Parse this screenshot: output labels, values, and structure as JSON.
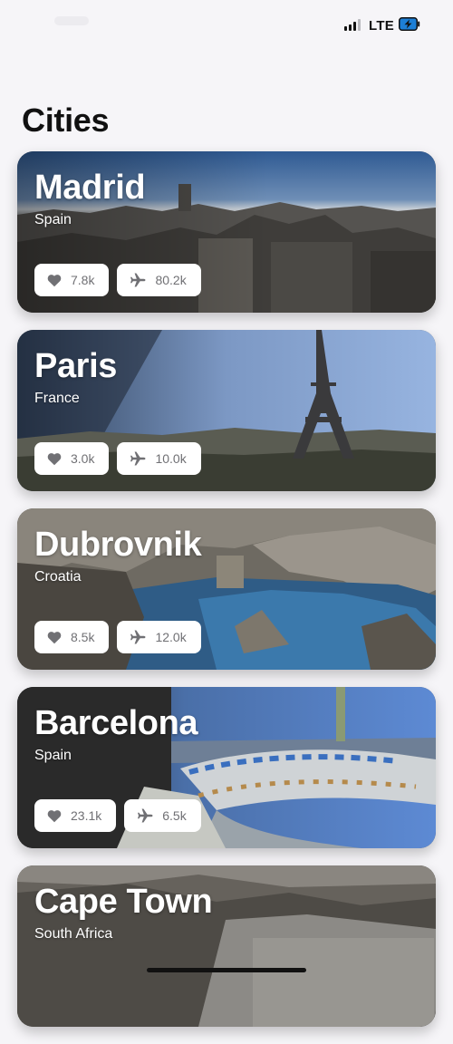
{
  "status_bar": {
    "network": "LTE",
    "icons": [
      "signal-icon",
      "battery-charging-icon"
    ]
  },
  "page": {
    "title": "Cities"
  },
  "cities": [
    {
      "name": "Madrid",
      "country": "Spain",
      "likes": "7.8k",
      "flights": "80.2k"
    },
    {
      "name": "Paris",
      "country": "France",
      "likes": "3.0k",
      "flights": "10.0k"
    },
    {
      "name": "Dubrovnik",
      "country": "Croatia",
      "likes": "8.5k",
      "flights": "12.0k"
    },
    {
      "name": "Barcelona",
      "country": "Spain",
      "likes": "23.1k",
      "flights": "6.5k"
    },
    {
      "name": "Cape Town",
      "country": "South Africa"
    }
  ],
  "chip_icons": {
    "likes": "heart-icon",
    "flights": "airplane-icon"
  },
  "colors": {
    "background": "#f6f5f8",
    "chip_text": "#707074",
    "title": "#111111"
  }
}
